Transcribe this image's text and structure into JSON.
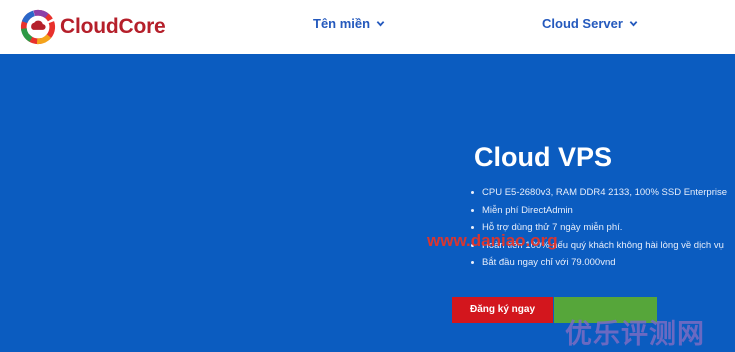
{
  "header": {
    "logo_text": "CloudCore",
    "nav": {
      "domain_label": "Tên miền",
      "server_label": "Cloud Server"
    }
  },
  "hero": {
    "title": "Cloud VPS",
    "features": [
      "CPU E5-2680v3, RAM DDR4 2133, 100% SSD Enterprise",
      "Miễn phí DirectAdmin",
      "Hỗ trợ dùng thử 7 ngày miễn phí.",
      "Hoàn tiền 100% nếu quý khách không hài lòng về dịch vụ",
      "Bắt đầu ngay chỉ với 79.000vnd"
    ],
    "register_label": "Đăng ký ngay"
  },
  "watermarks": {
    "url": "www.daniao.org",
    "cn": "优乐评测网"
  },
  "colors": {
    "hero_bg": "#0b5cc0",
    "nav_text": "#2459bd",
    "brand_red": "#b51f2a",
    "register_button": "#d3161d",
    "secondary_button": "#56a63a"
  }
}
